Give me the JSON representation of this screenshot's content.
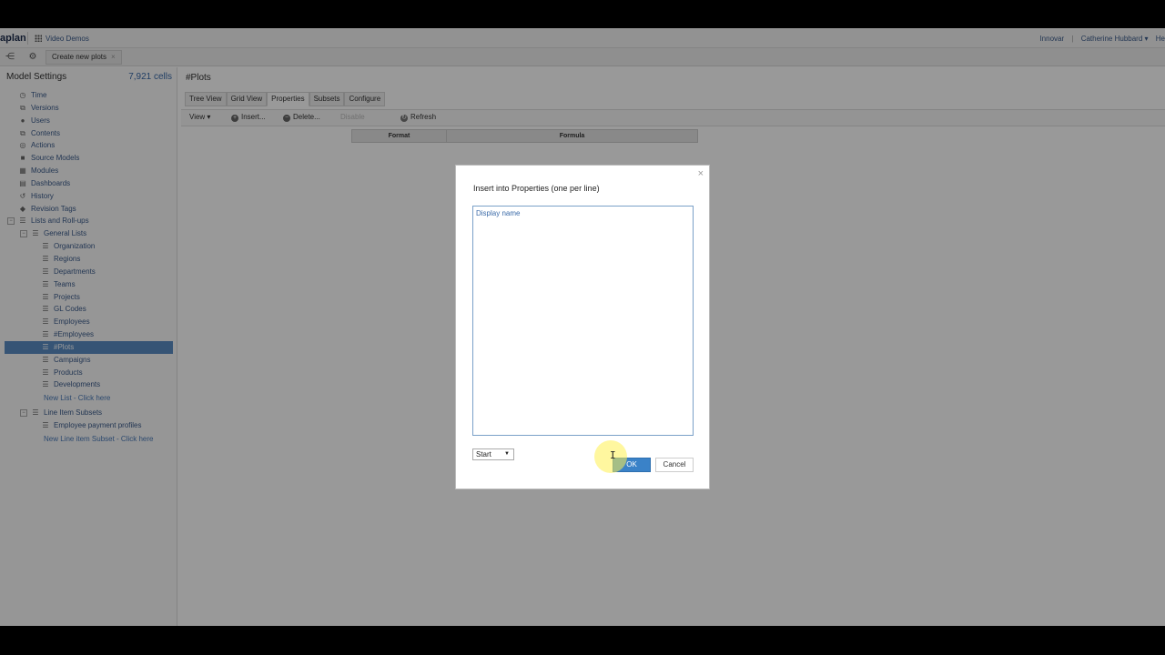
{
  "header": {
    "logo": "aplan",
    "app_name": "Video Demos",
    "workspace": "Innovar",
    "separator": "|",
    "user": "Catherine Hubbard ▾",
    "help": "He"
  },
  "subbar": {
    "tab_label": "Create new plots",
    "tab_close": "×"
  },
  "sidebar": {
    "title": "Model Settings",
    "cells": "7,921 cells",
    "items": [
      {
        "label": "Time",
        "icon": "◷"
      },
      {
        "label": "Versions",
        "icon": "⧉"
      },
      {
        "label": "Users",
        "icon": "●"
      },
      {
        "label": "Contents",
        "icon": "⧉"
      },
      {
        "label": "Actions",
        "icon": "◎"
      },
      {
        "label": "Source Models",
        "icon": "■"
      },
      {
        "label": "Modules",
        "icon": "▦"
      },
      {
        "label": "Dashboards",
        "icon": "▤"
      },
      {
        "label": "History",
        "icon": "↺"
      },
      {
        "label": "Revision Tags",
        "icon": "◆"
      },
      {
        "label": "Lists and Roll-ups",
        "icon": "☰",
        "expander": "−"
      },
      {
        "label": "General Lists",
        "icon": "☰",
        "expander": "−"
      },
      {
        "label": "Organization",
        "icon": "☰"
      },
      {
        "label": "Regions",
        "icon": "☰"
      },
      {
        "label": "Departments",
        "icon": "☰"
      },
      {
        "label": "Teams",
        "icon": "☰"
      },
      {
        "label": "Projects",
        "icon": "☰"
      },
      {
        "label": "GL Codes",
        "icon": "☰"
      },
      {
        "label": "Employees",
        "icon": "☰"
      },
      {
        "label": "#Employees",
        "icon": "☰"
      },
      {
        "label": "#Plots",
        "icon": "☰"
      },
      {
        "label": "Campaigns",
        "icon": "☰"
      },
      {
        "label": "Products",
        "icon": "☰"
      },
      {
        "label": "Developments",
        "icon": "☰"
      },
      {
        "label": "New List - Click here"
      },
      {
        "label": "Line Item Subsets",
        "icon": "☰",
        "expander": "−"
      },
      {
        "label": "Employee payment profiles",
        "icon": "☰"
      },
      {
        "label": "New Line item Subset - Click here"
      }
    ]
  },
  "main": {
    "title": "#Plots",
    "tabs": [
      "Tree View",
      "Grid View",
      "Properties",
      "Subsets",
      "Configure"
    ],
    "toolbar": {
      "view": "View ▾",
      "insert": "Insert...",
      "delete": "Delete...",
      "disabled": "Disable",
      "refresh": "Refresh"
    },
    "columns": [
      "Format",
      "Formula"
    ]
  },
  "dialog": {
    "title": "Insert into Properties (one per line)",
    "text_value": "Display name",
    "select_value": "Start",
    "ok_label": "OK",
    "cancel_label": "Cancel",
    "close": "×",
    "cursor": "I"
  }
}
